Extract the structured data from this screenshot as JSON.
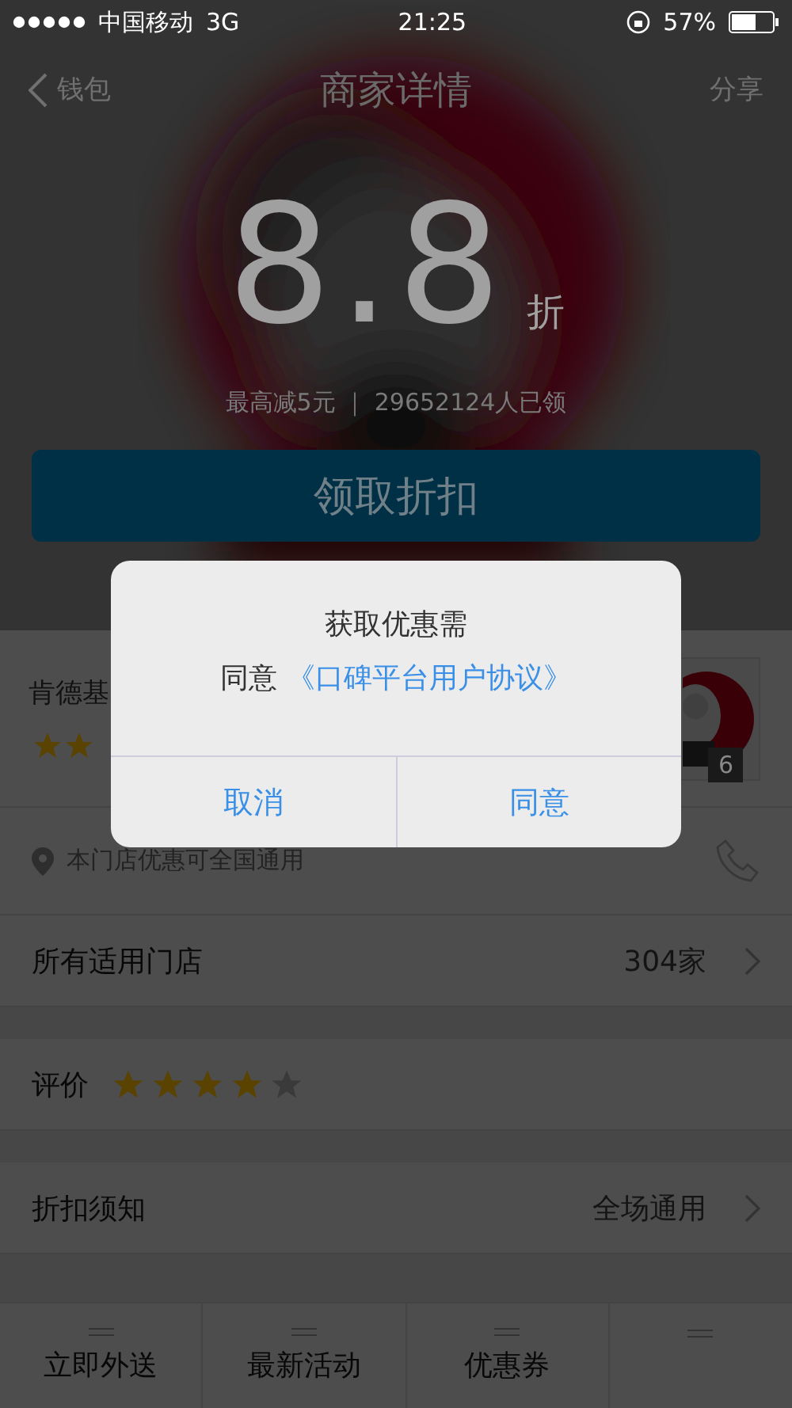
{
  "status_bar": {
    "carrier": "中国移动",
    "network": "3G",
    "time": "21:25",
    "battery": "57%"
  },
  "nav": {
    "back": "钱包",
    "title": "商家详情",
    "action": "分享"
  },
  "offer": {
    "discount": "8.8",
    "unit": "折",
    "subtitle": "最高减5元 ｜ 29652124人已领",
    "button": "领取折扣"
  },
  "merchant": {
    "name": "肯德基",
    "photo_count": "6",
    "location": "本门店优惠可全国通用"
  },
  "rows": [
    {
      "kind": "link",
      "label": "所有适用门店",
      "value": "304家"
    },
    {
      "kind": "rating",
      "label": "评价",
      "stars": 4
    },
    {
      "kind": "link",
      "label": "折扣须知",
      "value": "全场通用"
    }
  ],
  "tabs": [
    "立即外送",
    "最新活动",
    "优惠券"
  ],
  "dialog": {
    "title": "获取优惠需",
    "prefix": "同意",
    "link": "《口碑平台用户协议》",
    "buttons": [
      "取消",
      "同意"
    ]
  }
}
